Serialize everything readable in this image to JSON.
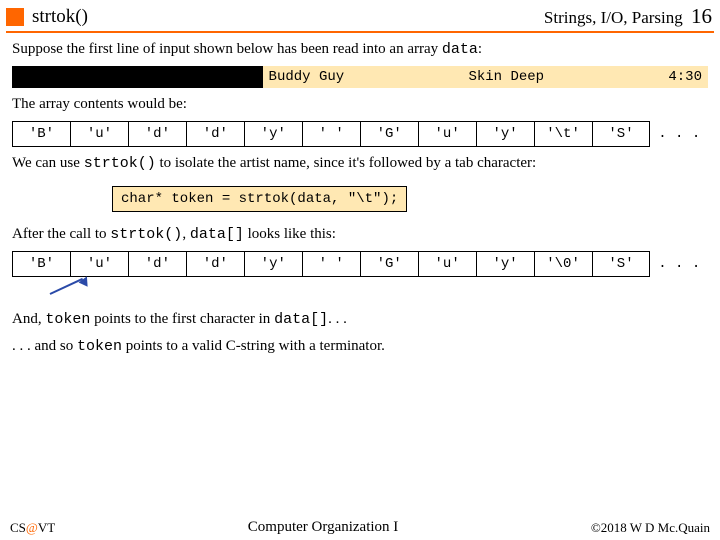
{
  "header": {
    "title": "strtok()",
    "section": "Strings, I/O, Parsing",
    "page": "16"
  },
  "intro_a": "Suppose the first line of input shown below has been read into an array ",
  "intro_code": "data",
  "intro_b": ":",
  "input": {
    "c1": "Buddy Guy",
    "c2": "Skin Deep",
    "c3": "4:30"
  },
  "arr_note": "The array contents would be:",
  "arr1": [
    "'B'",
    "'u'",
    "'d'",
    "'d'",
    "'y'",
    "' '",
    "'G'",
    "'u'",
    "'y'",
    "'\\t'",
    "'S'",
    ". . ."
  ],
  "use_a": "We can use ",
  "use_code": "strtok()",
  "use_b": " to isolate the artist name, since it's followed by a tab character:",
  "code_line": "char* token = strtok(data, \"\\t\");",
  "after_a": "After the call to ",
  "after_code1": "strtok()",
  "after_mid": ", ",
  "after_code2": "data[]",
  "after_b": " looks like this:",
  "arr2": [
    "'B'",
    "'u'",
    "'d'",
    "'d'",
    "'y'",
    "' '",
    "'G'",
    "'u'",
    "'y'",
    "'\\0'",
    "'S'",
    ". . ."
  ],
  "tail1_a": "And, ",
  "tail1_code1": "token",
  "tail1_b": " points to the first character in ",
  "tail1_code2": "data[]",
  "tail1_c": ". . .",
  "tail2_a": ". . . and so ",
  "tail2_code": "token",
  "tail2_b": " points to a valid C-string with a terminator.",
  "footer": {
    "left_a": "CS",
    "left_at": "@",
    "left_b": "VT",
    "center": "Computer Organization I",
    "right": "©2018 W D Mc.Quain"
  }
}
